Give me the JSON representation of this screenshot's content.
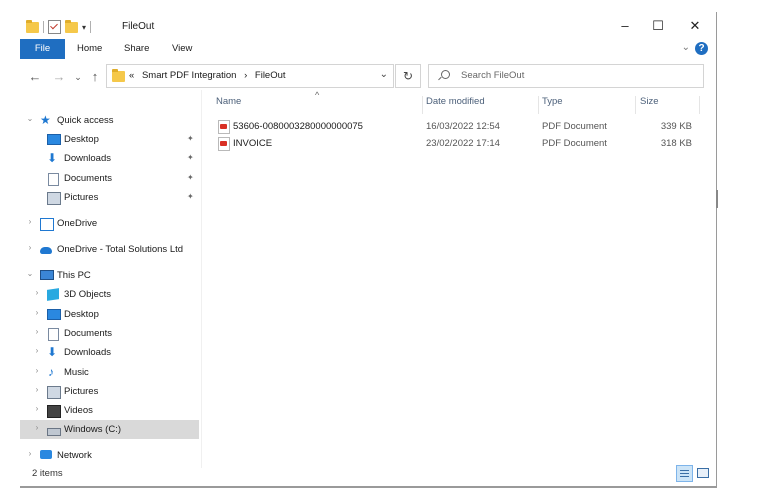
{
  "window": {
    "title": "FileOut",
    "controls": {
      "minimize": "–",
      "maximize": "☐",
      "close": "✕"
    }
  },
  "ribbon": {
    "tabs": [
      "File",
      "Home",
      "Share",
      "View"
    ],
    "help": "?",
    "collapse": "⌄"
  },
  "nav_buttons": {
    "back": "←",
    "forward": "→",
    "recent": "⌄",
    "up": "↑",
    "refresh": "↻"
  },
  "address": {
    "overflow": "«",
    "segments": [
      "Smart PDF Integration",
      "FileOut"
    ],
    "separator": "›"
  },
  "search": {
    "placeholder": "Search FileOut"
  },
  "sidebar": {
    "items": [
      {
        "label": "Quick access",
        "icon": "star-icon"
      },
      {
        "label": "Desktop",
        "icon": "desktop-icon",
        "pinned": true
      },
      {
        "label": "Downloads",
        "icon": "download-icon",
        "pinned": true
      },
      {
        "label": "Documents",
        "icon": "document-icon",
        "pinned": true
      },
      {
        "label": "Pictures",
        "icon": "pictures-icon",
        "pinned": true
      },
      {
        "label": "OneDrive",
        "icon": "onedrive-icon"
      },
      {
        "label": "OneDrive - Total Solutions Ltd",
        "icon": "cloud-icon"
      },
      {
        "label": "This PC",
        "icon": "computer-icon"
      },
      {
        "label": "3D Objects",
        "icon": "cube-icon"
      },
      {
        "label": "Desktop",
        "icon": "desktop-icon"
      },
      {
        "label": "Documents",
        "icon": "document-icon"
      },
      {
        "label": "Downloads",
        "icon": "download-icon"
      },
      {
        "label": "Music",
        "icon": "music-icon"
      },
      {
        "label": "Pictures",
        "icon": "pictures-icon"
      },
      {
        "label": "Videos",
        "icon": "video-icon"
      },
      {
        "label": "Windows (C:)",
        "icon": "drive-icon",
        "selected": true
      },
      {
        "label": "Network",
        "icon": "network-icon"
      }
    ]
  },
  "columns": [
    "Name",
    "Date modified",
    "Type",
    "Size"
  ],
  "files": [
    {
      "name": "53606-0080003280000000075",
      "date": "16/03/2022 12:54",
      "type": "PDF Document",
      "size": "339 KB"
    },
    {
      "name": "INVOICE",
      "date": "23/02/2022 17:14",
      "type": "PDF Document",
      "size": "318 KB"
    }
  ],
  "status": {
    "count": "2 items"
  }
}
